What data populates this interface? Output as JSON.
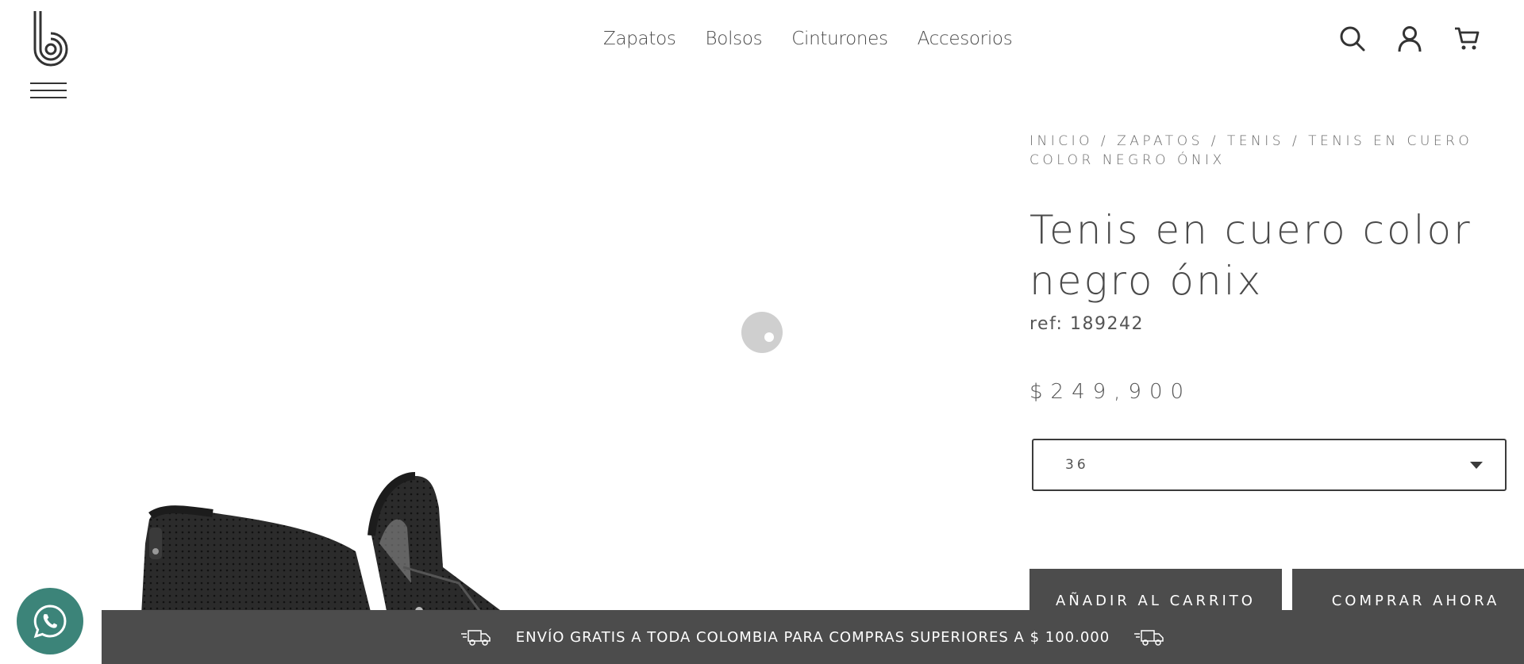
{
  "header": {
    "logo_icon": "brand-b-logo",
    "menu_icon": "hamburger-menu-icon",
    "nav": [
      "Zapatos",
      "Bolsos",
      "Cinturones",
      "Accesorios"
    ],
    "icons": [
      "search-icon",
      "user-icon",
      "cart-icon"
    ]
  },
  "breadcrumb": {
    "items": [
      "INICIO",
      "ZAPATOS",
      "TENIS",
      "TENIS EN CUERO COLOR NEGRO ÓNIX"
    ],
    "separator": " / "
  },
  "product": {
    "title": "Tenis en cuero color negro ónix",
    "ref": "ref: 189242",
    "price": "$249,900",
    "size_selected": "36",
    "add_to_cart_label": "AÑADIR AL CARRITO",
    "buy_now_label": "COMPRAR AHORA"
  },
  "banner": {
    "text": "ENVÍO GRATIS A TODA COLOMBIA PARA COMPRAS SUPERIORES A $ 100.000",
    "icon": "delivery-truck-icon"
  },
  "whatsapp": {
    "icon": "whatsapp-icon",
    "color": "#3c8479"
  },
  "colors": {
    "dark": "#4c4c4c",
    "text": "#4a4a4a"
  }
}
